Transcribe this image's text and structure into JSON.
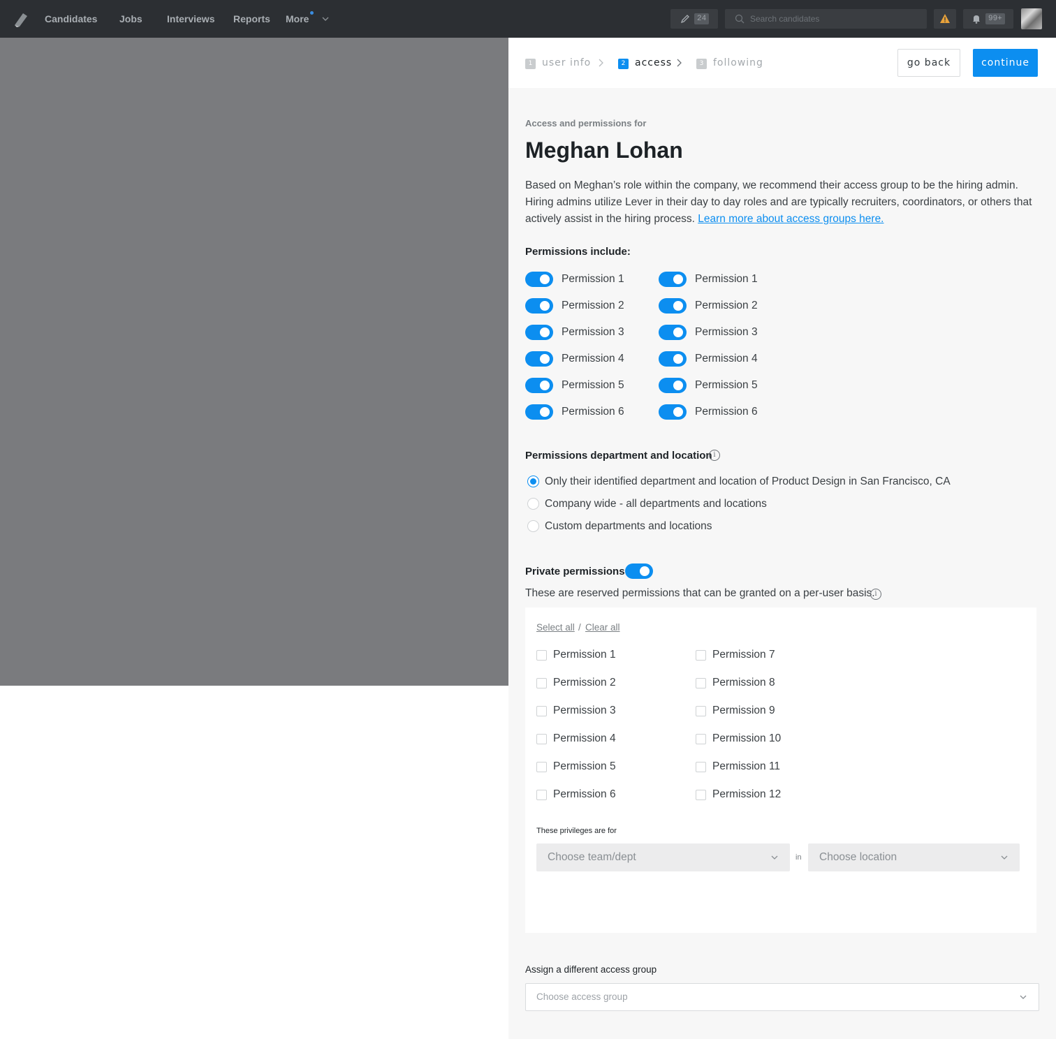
{
  "nav": {
    "items": [
      "Candidates",
      "Jobs",
      "Interviews",
      "Reports",
      "More"
    ],
    "compose_count": "24",
    "search_placeholder": "Search candidates",
    "notification_count": "99+"
  },
  "wizard": {
    "steps": [
      {
        "num": "1",
        "label": "user info",
        "state": "done"
      },
      {
        "num": "2",
        "label": "access",
        "state": "active"
      },
      {
        "num": "3",
        "label": "following",
        "state": "pending"
      }
    ],
    "back_label": "go back",
    "continue_label": "continue"
  },
  "header": {
    "eyebrow": "Access and permissions for",
    "name": "Meghan Lohan",
    "description": "Based on Meghan’s role within the company, we recommend their access group to be the hiring admin. Hiring admins utilize Lever in their day to day roles and are typically recruiters, coordinators, or others that actively assist in the hiring process.",
    "learn_more": "Learn more about access groups here."
  },
  "permissions": {
    "heading": "Permissions include:",
    "left": [
      {
        "label": "Permission 1",
        "on": true
      },
      {
        "label": "Permission 2",
        "on": true
      },
      {
        "label": "Permission 3",
        "on": true
      },
      {
        "label": "Permission 4",
        "on": true
      },
      {
        "label": "Permission 5",
        "on": true
      },
      {
        "label": "Permission 6",
        "on": true
      }
    ],
    "right": [
      {
        "label": "Permission 1",
        "on": true
      },
      {
        "label": "Permission 2",
        "on": true
      },
      {
        "label": "Permission 3",
        "on": true
      },
      {
        "label": "Permission 4",
        "on": true
      },
      {
        "label": "Permission 5",
        "on": true
      },
      {
        "label": "Permission 6",
        "on": true
      }
    ]
  },
  "scope": {
    "heading": "Permissions department and location",
    "options": [
      {
        "label": "Only their identified department and location of Product Design in San Francisco, CA",
        "selected": true
      },
      {
        "label": "Company wide - all departments and locations",
        "selected": false
      },
      {
        "label": "Custom departments and locations",
        "selected": false
      }
    ]
  },
  "private": {
    "heading": "Private permissions",
    "enabled": true,
    "description": "These are reserved permissions that can be granted on a per-user basis.",
    "select_all": "Select all",
    "separator": "/",
    "clear_all": "Clear all",
    "col1": [
      "Permission 1",
      "Permission 2",
      "Permission 3",
      "Permission 4",
      "Permission 5",
      "Permission 6"
    ],
    "col2": [
      "Permission 7",
      "Permission 8",
      "Permission 9",
      "Permission 10",
      "Permission 11",
      "Permission 12"
    ],
    "for_label": "These privileges are for",
    "team_placeholder": "Choose team/dept",
    "in_label": "in",
    "location_placeholder": "Choose location"
  },
  "assign": {
    "label": "Assign a different access group",
    "placeholder": "Choose access group"
  },
  "colors": {
    "accent": "#0c8ef0",
    "nav_bg": "#2c2f33",
    "overlay": "#7a7b7e",
    "panel_bg": "#f7f7f7"
  }
}
